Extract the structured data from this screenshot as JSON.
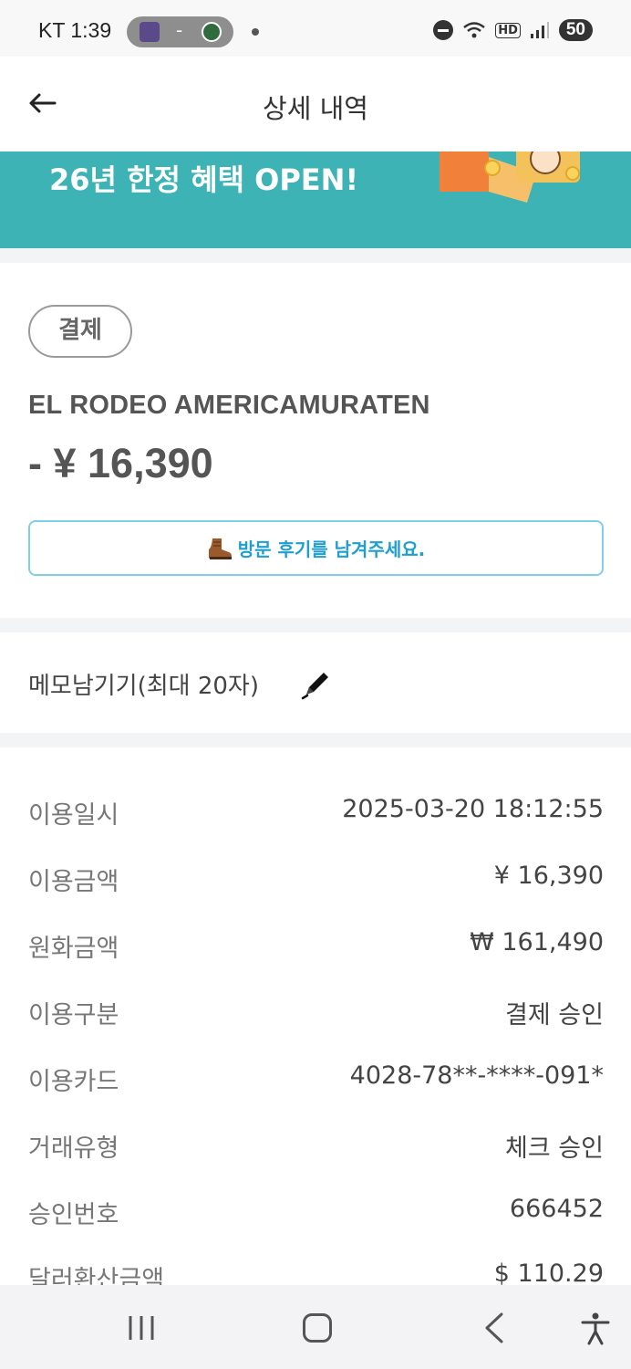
{
  "status_bar": {
    "carrier_time": "KT 1:39",
    "score_dash": "-",
    "hd_label": "HD",
    "battery": "50"
  },
  "header": {
    "title": "상세 내역"
  },
  "banner": {
    "text": "26년 한정 혜택 OPEN!"
  },
  "payment": {
    "badge": "결제",
    "merchant": "EL RODEO AMERICAMURATEN",
    "amount": "- ¥ 16,390",
    "review_button": "방문 후기를 남겨주세요."
  },
  "memo": {
    "label": "메모남기기(최대 20자)"
  },
  "details": [
    {
      "label": "이용일시",
      "value": "2025-03-20 18:12:55"
    },
    {
      "label": "이용금액",
      "value": "¥ 16,390"
    },
    {
      "label": "원화금액",
      "value": "₩ 161,490"
    },
    {
      "label": "이용구분",
      "value": "결제 승인"
    },
    {
      "label": "이용카드",
      "value": "4028-78**-****-091*"
    },
    {
      "label": "거래유형",
      "value": "체크 승인"
    },
    {
      "label": "승인번호",
      "value": "666452"
    },
    {
      "label": "달러환산금액",
      "value": "$ 110.29"
    }
  ],
  "colors": {
    "banner": "#3db3b5",
    "review_accent": "#1f9fcf",
    "review_border": "#7fd0e6"
  }
}
